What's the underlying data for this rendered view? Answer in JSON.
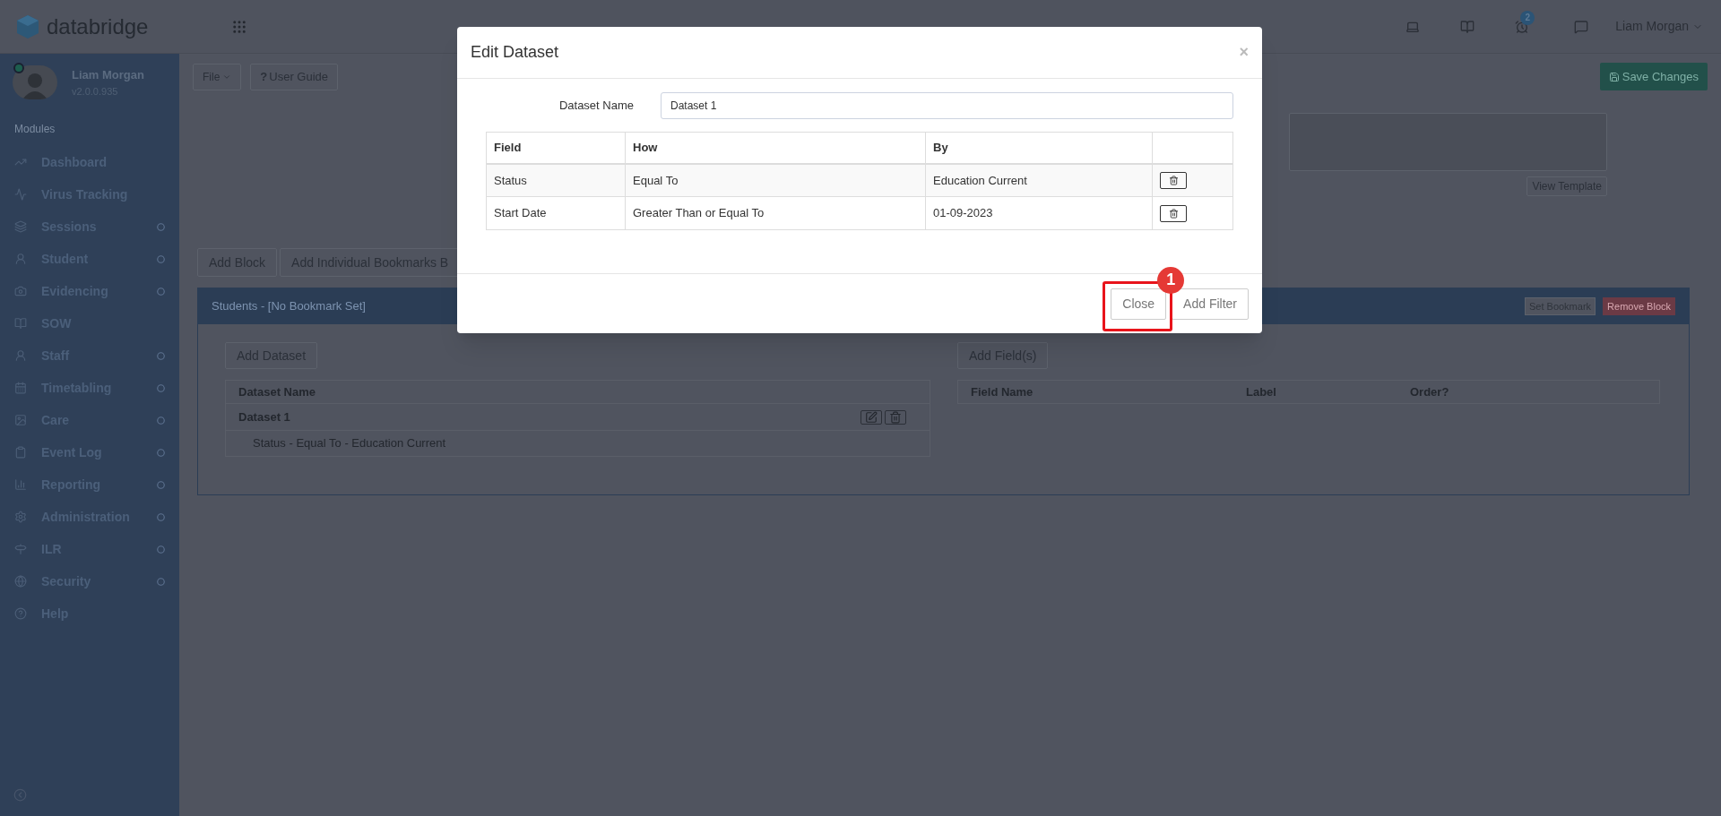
{
  "header": {
    "logo": "databridge",
    "notification_count": "2",
    "user_menu": "Liam Morgan"
  },
  "sidebar": {
    "user": {
      "name": "Liam Morgan",
      "version": "v2.0.0.935",
      "online": true
    },
    "section": "Modules",
    "items": [
      {
        "label": "Dashboard",
        "expandable": false
      },
      {
        "label": "Virus Tracking",
        "expandable": false
      },
      {
        "label": "Sessions",
        "expandable": true
      },
      {
        "label": "Student",
        "expandable": true
      },
      {
        "label": "Evidencing",
        "expandable": true
      },
      {
        "label": "SOW",
        "expandable": false
      },
      {
        "label": "Staff",
        "expandable": true
      },
      {
        "label": "Timetabling",
        "expandable": true
      },
      {
        "label": "Care",
        "expandable": true
      },
      {
        "label": "Event Log",
        "expandable": true
      },
      {
        "label": "Reporting",
        "expandable": true
      },
      {
        "label": "Administration",
        "expandable": true
      },
      {
        "label": "ILR",
        "expandable": true
      },
      {
        "label": "Security",
        "expandable": true
      },
      {
        "label": "Help",
        "expandable": false
      }
    ]
  },
  "toolbar": {
    "file_menu": "File",
    "user_guide_icon": "?",
    "user_guide": "User Guide",
    "save": "Save Changes"
  },
  "template": {
    "button": "View Template"
  },
  "block_buttons": [
    "Add Block",
    "Add Individual Bookmarks B"
  ],
  "block": {
    "title": "Students - [No Bookmark Set]",
    "set_bookmark": "Set Bookmark",
    "remove_block": "Remove Block",
    "add_dataset": "Add Dataset",
    "dataset_table": {
      "columns": [
        "Dataset Name"
      ],
      "datasets": [
        {
          "name": "Dataset 1",
          "filters": [
            "Status - Equal To - Education Current"
          ]
        }
      ]
    },
    "add_fields": "Add Field(s)",
    "field_table": {
      "columns": [
        "Field Name",
        "Label",
        "Order?"
      ]
    }
  },
  "modal": {
    "title": "Edit Dataset",
    "close_icon": "×",
    "name_label": "Dataset Name",
    "name_value": "Dataset 1",
    "columns": [
      "Field",
      "How",
      "By"
    ],
    "rows": [
      {
        "field": "Status",
        "how": "Equal To",
        "by": "Education Current"
      },
      {
        "field": "Start Date",
        "how": "Greater Than or Equal To",
        "by": "01-09-2023"
      }
    ],
    "buttons": [
      "Close",
      "Add Filter"
    ]
  },
  "annotation": {
    "badge": "1"
  }
}
